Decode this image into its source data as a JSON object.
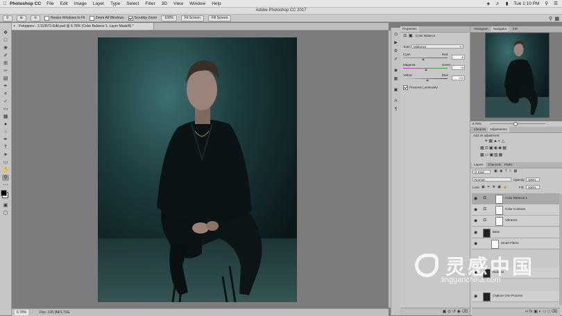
{
  "menubar": {
    "app_name": "Photoshop CC",
    "items": [
      "File",
      "Edit",
      "Image",
      "Layer",
      "Type",
      "Select",
      "Filter",
      "3D",
      "View",
      "Window",
      "Help"
    ],
    "clock": "Tue 1:10 PM"
  },
  "window_title": "Adobe Photoshop CC 2017",
  "options_bar": {
    "resize_windows_label": "Resize Windows to Fit",
    "zoom_all_label": "Zoom All Windows",
    "scrubby_zoom_label": "Scrubby Zoom",
    "zoom_value": "100%",
    "fit_screen_label": "Fit Screen",
    "fill_screen_label": "Fill Screen"
  },
  "document": {
    "tab_title": "Fotoppers - 2.119571-Edit.psd @ 6.78% (Color Balance 1, Layer Mask/8) *",
    "zoom": "6.78%",
    "doc_size": "Doc: 120.3M/1.71G"
  },
  "properties": {
    "tabs": [
      "Properties"
    ],
    "adjustment_title": "Color Balance",
    "tone_label": "Tone:",
    "tone_value": "Midtones",
    "sliders": [
      {
        "left": "Cyan",
        "right": "Red",
        "value": "-8",
        "fraction": 0.46
      },
      {
        "left": "Magenta",
        "right": "Green",
        "value": "+5",
        "fraction": 0.52
      },
      {
        "left": "Yellow",
        "right": "Blue",
        "value": "+10",
        "fraction": 0.55
      }
    ],
    "preserve_luminosity": "Preserve Luminosity"
  },
  "navigator": {
    "tabs": [
      "Histogram",
      "Navigator",
      "Info"
    ],
    "zoom": "6.78%"
  },
  "adjustments": {
    "tabs": [
      "Libraries",
      "Adjustments"
    ],
    "prompt": "Add an adjustment"
  },
  "layers_panel": {
    "tabs": [
      "Layers",
      "Channels",
      "Paths"
    ],
    "filter_kind": "Kind",
    "blend_mode": "Normal",
    "opacity_label": "Opacity:",
    "opacity_value": "100%",
    "lock_label": "Lock:",
    "fill_label": "Fill:",
    "fill_value": "100%",
    "layers": [
      {
        "name": "Color Balance 1",
        "selected": true
      },
      {
        "name": "Color Contrast",
        "selected": false
      },
      {
        "name": "Vibrance",
        "selected": false
      },
      {
        "name": "Base",
        "selected": false
      },
      {
        "name": "Smart Filters",
        "selected": false
      },
      {
        "name": "Dekmist",
        "selected": false
      },
      {
        "name": "Capture One Process",
        "selected": false
      }
    ]
  },
  "watermark": {
    "brand": "灵感中国",
    "url": "lingganchina.com"
  },
  "colors": {
    "menubar_bg": "#e6e6e6",
    "panel_bg": "#c8c8c8",
    "canvas_bg": "#7c7c7c",
    "navigator_outline": "#e11"
  }
}
